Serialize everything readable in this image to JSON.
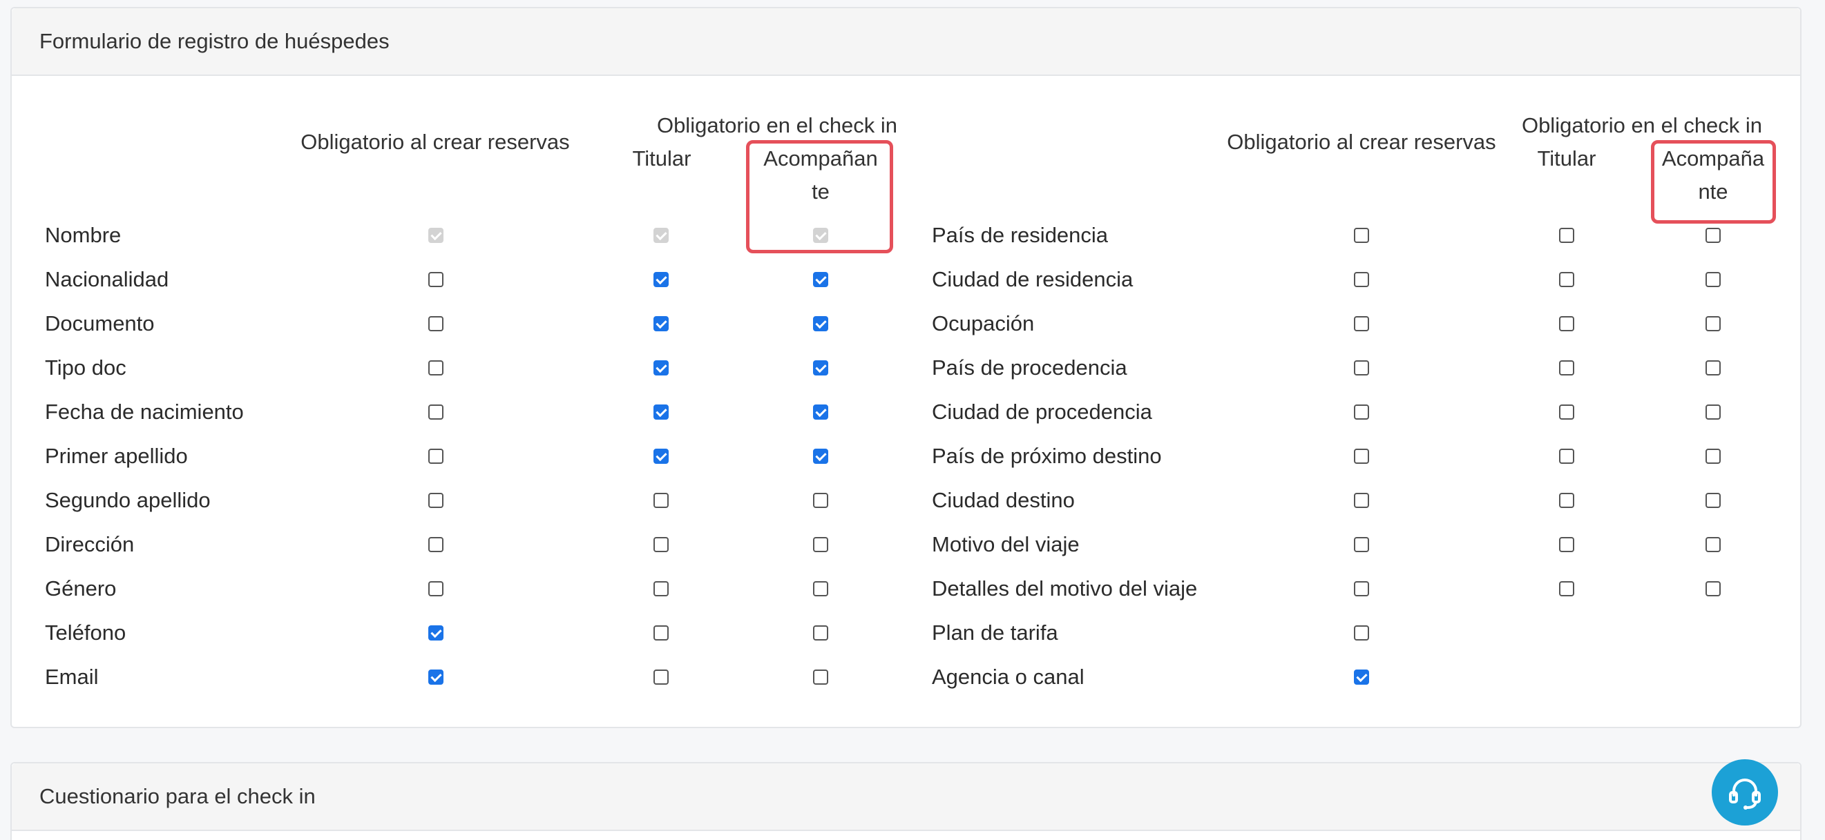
{
  "panel1": {
    "title": "Formulario de registro de huéspedes",
    "left": {
      "headers": {
        "crear": "Obligatorio al crear reservas",
        "checkin": "Obligatorio en el check in",
        "titular": "Titular",
        "acomp_line1": "Acompañan",
        "acomp_line2": "te"
      },
      "rows": [
        {
          "label": "Nombre",
          "crear": "disabled",
          "titular": "disabled",
          "acomp": "disabled"
        },
        {
          "label": "Nacionalidad",
          "crear": "unchecked",
          "titular": "checked",
          "acomp": "checked"
        },
        {
          "label": "Documento",
          "crear": "unchecked",
          "titular": "checked",
          "acomp": "checked"
        },
        {
          "label": "Tipo doc",
          "crear": "unchecked",
          "titular": "checked",
          "acomp": "checked"
        },
        {
          "label": "Fecha de nacimiento",
          "crear": "unchecked",
          "titular": "checked",
          "acomp": "checked"
        },
        {
          "label": "Primer apellido",
          "crear": "unchecked",
          "titular": "checked",
          "acomp": "checked"
        },
        {
          "label": "Segundo apellido",
          "crear": "unchecked",
          "titular": "unchecked",
          "acomp": "unchecked"
        },
        {
          "label": "Dirección",
          "crear": "unchecked",
          "titular": "unchecked",
          "acomp": "unchecked"
        },
        {
          "label": "Género",
          "crear": "unchecked",
          "titular": "unchecked",
          "acomp": "unchecked"
        },
        {
          "label": "Teléfono",
          "crear": "checked",
          "titular": "unchecked",
          "acomp": "unchecked"
        },
        {
          "label": "Email",
          "crear": "checked",
          "titular": "unchecked",
          "acomp": "unchecked"
        }
      ]
    },
    "right": {
      "headers": {
        "crear": "Obligatorio al crear reservas",
        "checkin": "Obligatorio en el check in",
        "titular": "Titular",
        "acomp_line1": "Acompaña",
        "acomp_line2": "nte"
      },
      "rows": [
        {
          "label": "País de residencia",
          "crear": "unchecked",
          "titular": "unchecked",
          "acomp": "unchecked"
        },
        {
          "label": "Ciudad de residencia",
          "crear": "unchecked",
          "titular": "unchecked",
          "acomp": "unchecked"
        },
        {
          "label": "Ocupación",
          "crear": "unchecked",
          "titular": "unchecked",
          "acomp": "unchecked"
        },
        {
          "label": "País de procedencia",
          "crear": "unchecked",
          "titular": "unchecked",
          "acomp": "unchecked"
        },
        {
          "label": "Ciudad de procedencia",
          "crear": "unchecked",
          "titular": "unchecked",
          "acomp": "unchecked"
        },
        {
          "label": "País de próximo destino",
          "crear": "unchecked",
          "titular": "unchecked",
          "acomp": "unchecked"
        },
        {
          "label": "Ciudad destino",
          "crear": "unchecked",
          "titular": "unchecked",
          "acomp": "unchecked"
        },
        {
          "label": "Motivo del viaje",
          "crear": "unchecked",
          "titular": "unchecked",
          "acomp": "unchecked"
        },
        {
          "label": "Detalles del motivo del viaje",
          "crear": "unchecked",
          "titular": "unchecked",
          "acomp": "unchecked"
        },
        {
          "label": "Plan de tarifa",
          "crear": "unchecked",
          "titular": null,
          "acomp": null
        },
        {
          "label": "Agencia o canal",
          "crear": "checked",
          "titular": null,
          "acomp": null
        }
      ]
    }
  },
  "panel2": {
    "title": "Cuestionario para el check in"
  },
  "support_button": {
    "icon": "headset-icon"
  }
}
